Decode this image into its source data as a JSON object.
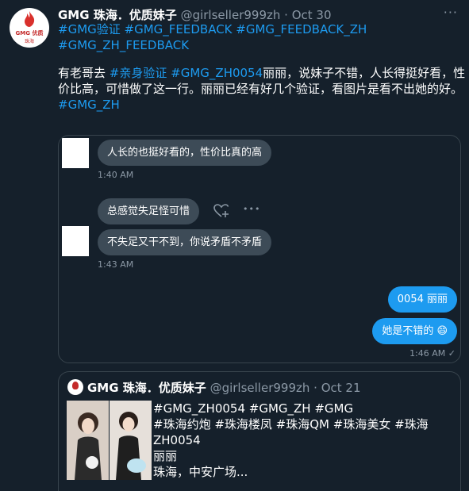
{
  "tweet": {
    "avatar_text_1": "GMG 优质",
    "avatar_text_2": "珠海",
    "display_name": "GMG 珠海．优质妹子",
    "handle": "@girlseller999zh",
    "separator": "·",
    "date": "Oct 30",
    "more_label": "···",
    "hashtags": "#GMG验证 #GMG_FEEDBACK #GMG_FEEDBACK_ZH #GMG_ZH_FEEDBACK",
    "body_part1": "有老哥去",
    "body_link1": "#亲身验证",
    "body_link2": "#GMG_ZH0054",
    "body_part2": "丽丽，说妹子不错，人长得挺好看，性价比高，可惜做了这一行。丽丽已经有好几个验证，看图片是看不出她的好。",
    "body_link3": "#GMG_ZH"
  },
  "chat": {
    "messages": [
      {
        "text": "人长的也挺好看的，性价比真的高"
      },
      {
        "time": "1:40 AM"
      },
      {
        "text": "总感觉失足怪可惜"
      },
      {
        "text": "不失足又干不到，你说矛盾不矛盾"
      },
      {
        "time": "1:43 AM"
      },
      {
        "text": "0054 丽丽"
      },
      {
        "text": "她是不错的 😄"
      },
      {
        "time": "1:46 AM ✓"
      }
    ],
    "reaction_icon": "heart-add-icon",
    "options_icon": "ellipsis-icon",
    "options_label": "•••"
  },
  "quote": {
    "display_name": "GMG 珠海．优质妹子",
    "handle": "@girlseller999zh",
    "separator": "·",
    "date": "Oct 21",
    "text_line1": "#GMG_ZH0054 #GMG_ZH #GMG",
    "text_line2": "#珠海约炮 #珠海楼凤 #珠海QM #珠海美女 #珠海",
    "text_line3": "ZH0054",
    "text_line4": "丽丽",
    "text_line5": "珠海，中安广场..."
  },
  "colors": {
    "background": "#15202b",
    "link": "#1d9bf0",
    "muted": "#8b98a5",
    "bubble_grey": "#3d4b57",
    "bubble_blue": "#1d9bf0",
    "border": "#38444d"
  }
}
